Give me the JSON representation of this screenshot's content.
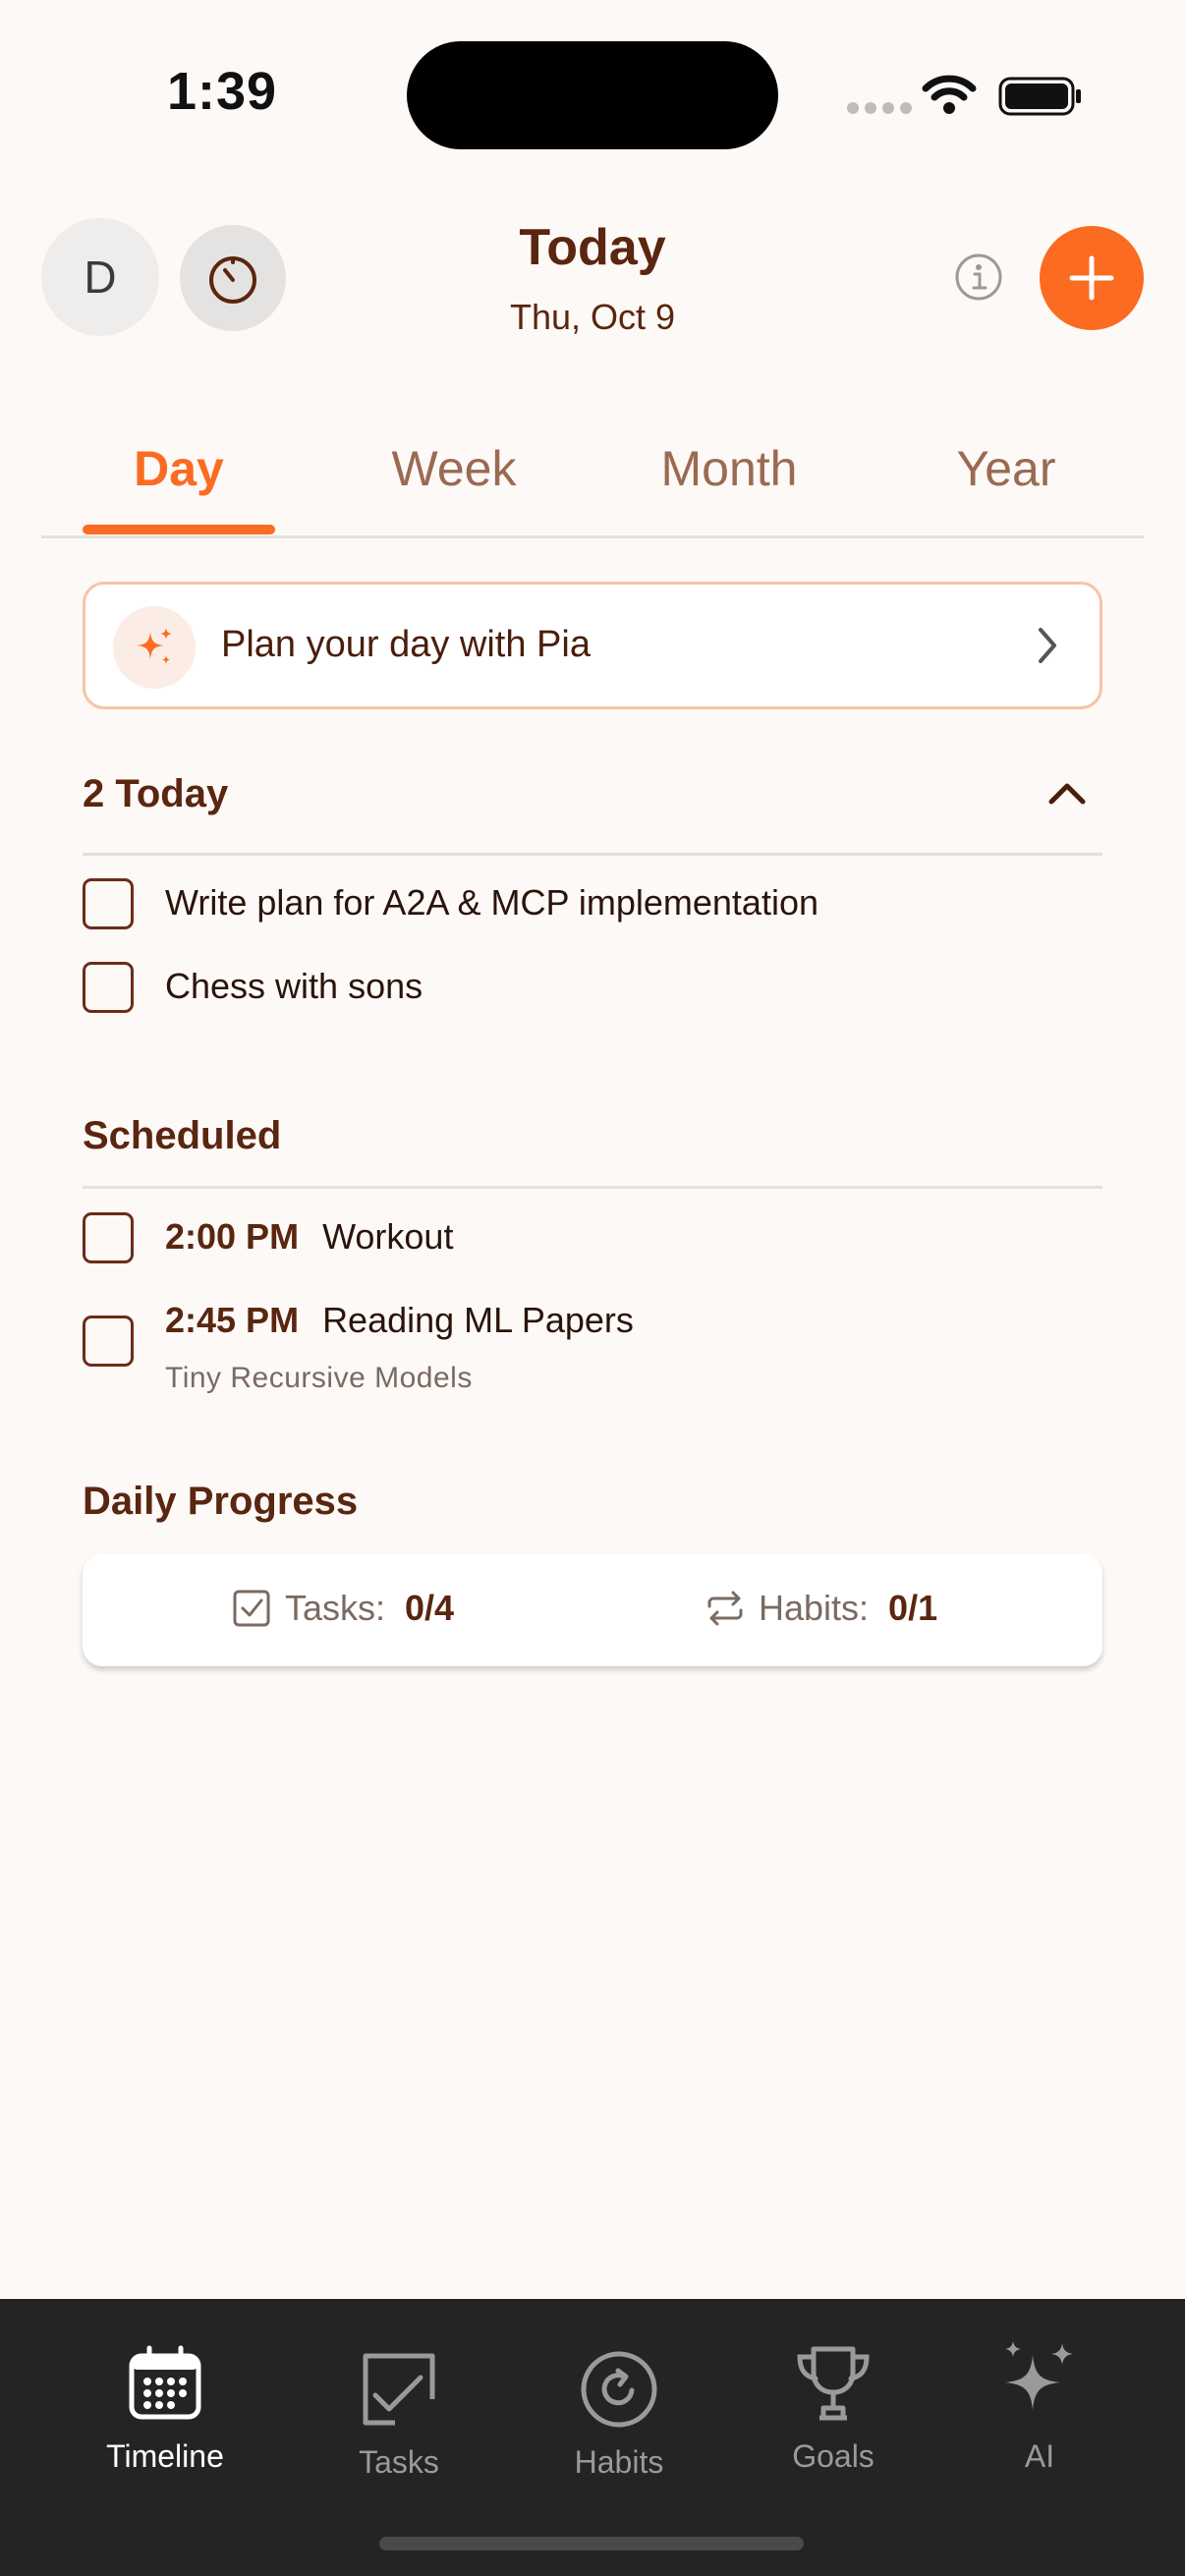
{
  "status_bar": {
    "time": "1:39"
  },
  "header": {
    "avatar_initial": "D",
    "title": "Today",
    "date": "Thu, Oct 9"
  },
  "tabs": [
    {
      "label": "Day",
      "active": true
    },
    {
      "label": "Week",
      "active": false
    },
    {
      "label": "Month",
      "active": false
    },
    {
      "label": "Year",
      "active": false
    }
  ],
  "pia_prompt": {
    "label": "Plan your day with Pia"
  },
  "today_section": {
    "heading": "2 Today",
    "tasks": [
      {
        "title": "Write plan for A2A & MCP implementation",
        "done": false
      },
      {
        "title": "Chess with sons",
        "done": false
      }
    ]
  },
  "scheduled_section": {
    "heading": "Scheduled",
    "tasks": [
      {
        "time": "2:00 PM",
        "title": "Workout",
        "subtitle": ""
      },
      {
        "time": "2:45 PM",
        "title": "Reading ML Papers",
        "subtitle": "Tiny Recursive Models"
      }
    ]
  },
  "daily_progress": {
    "heading": "Daily Progress",
    "tasks_label": "Tasks:",
    "tasks_value": "0/4",
    "habits_label": "Habits:",
    "habits_value": "0/1"
  },
  "bottom_nav": [
    {
      "label": "Timeline",
      "icon": "calendar-icon",
      "active": true
    },
    {
      "label": "Tasks",
      "icon": "task-check-icon",
      "active": false
    },
    {
      "label": "Habits",
      "icon": "habit-refresh-icon",
      "active": false
    },
    {
      "label": "Goals",
      "icon": "trophy-icon",
      "active": false
    },
    {
      "label": "AI",
      "icon": "sparkles-icon",
      "active": false
    }
  ],
  "colors": {
    "accent": "#fb6b21",
    "heading": "#5a2610",
    "background": "#fdf9f7",
    "nav_background": "#242424"
  }
}
